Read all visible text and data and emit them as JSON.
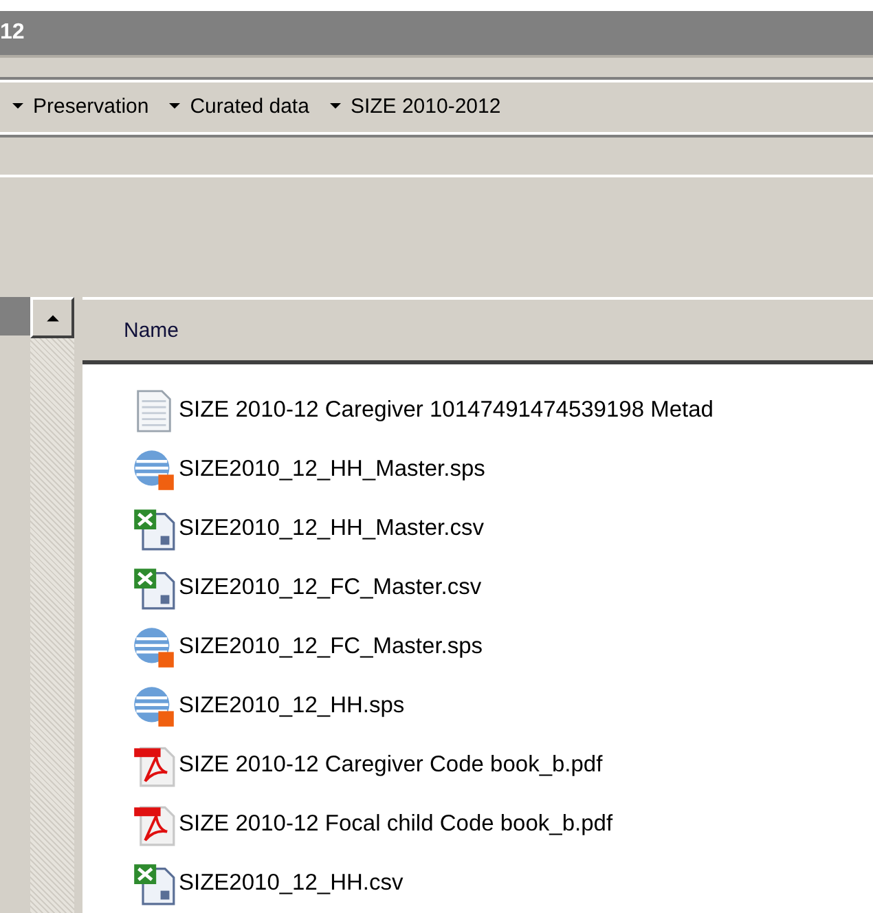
{
  "window": {
    "title": "12"
  },
  "breadcrumb": [
    {
      "label": "Preservation"
    },
    {
      "label": "Curated data"
    },
    {
      "label": "SIZE 2010-2012"
    }
  ],
  "file_list": {
    "columns": [
      "Name"
    ],
    "rows": [
      {
        "kind": "text",
        "name": "SIZE 2010-12 Caregiver 10147491474539198 Metad"
      },
      {
        "kind": "syntax",
        "name": "SIZE2010_12_HH_Master.sps"
      },
      {
        "kind": "spreadsheet",
        "name": "SIZE2010_12_HH_Master.csv"
      },
      {
        "kind": "spreadsheet",
        "name": "SIZE2010_12_FC_Master.csv"
      },
      {
        "kind": "syntax",
        "name": "SIZE2010_12_FC_Master.sps"
      },
      {
        "kind": "syntax",
        "name": "SIZE2010_12_HH.sps"
      },
      {
        "kind": "pdf",
        "name": "SIZE 2010-12 Caregiver Code book_b.pdf"
      },
      {
        "kind": "pdf",
        "name": "SIZE 2010-12 Focal child Code book_b.pdf"
      },
      {
        "kind": "spreadsheet",
        "name": "SIZE2010_12_HH.csv"
      }
    ]
  }
}
